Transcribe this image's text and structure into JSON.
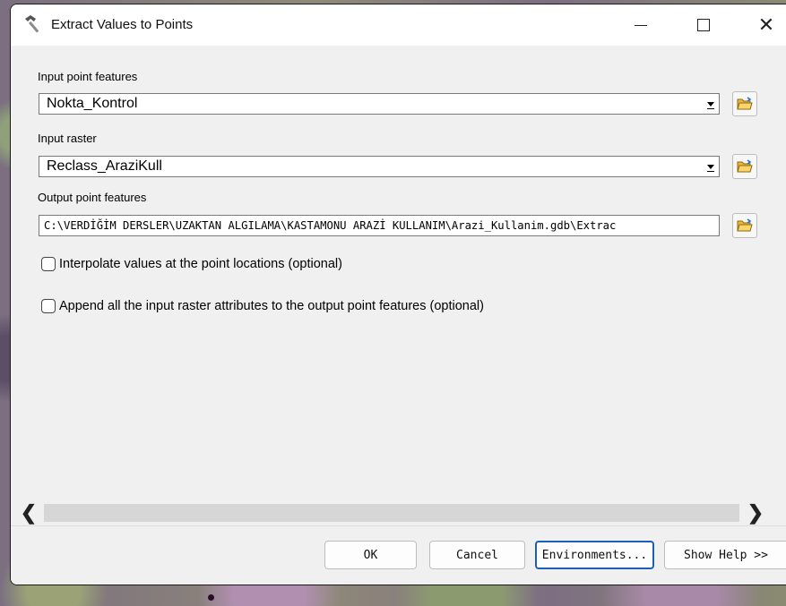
{
  "window": {
    "title": "Extract Values to Points",
    "close_glyph": "✕"
  },
  "form": {
    "input_point_features": {
      "label": "Input point features",
      "value": "Nokta_Kontrol"
    },
    "input_raster": {
      "label": "Input raster",
      "value": "Reclass_AraziKull"
    },
    "output_point_features": {
      "label": "Output point features",
      "value": "C:\\VERDİĞİM DERSLER\\UZAKTAN ALGILAMA\\KASTAMONU ARAZİ KULLANIM\\Arazi_Kullanim.gdb\\Extrac"
    },
    "interpolate": {
      "label": "Interpolate values at the point locations (optional)",
      "checked": false
    },
    "append_attributes": {
      "label": "Append all the input raster attributes to the output point features (optional)",
      "checked": false
    }
  },
  "scrollbar": {
    "left_glyph": "❮",
    "right_glyph": "❯"
  },
  "buttons": {
    "ok": "OK",
    "cancel": "Cancel",
    "environments": "Environments...",
    "show_help": "Show Help >>"
  },
  "icons": {
    "title": "hammer-icon",
    "browse": "folder-open-icon"
  },
  "colors": {
    "focus_border": "#1d5fb7",
    "folder_fill": "#f2b632"
  }
}
